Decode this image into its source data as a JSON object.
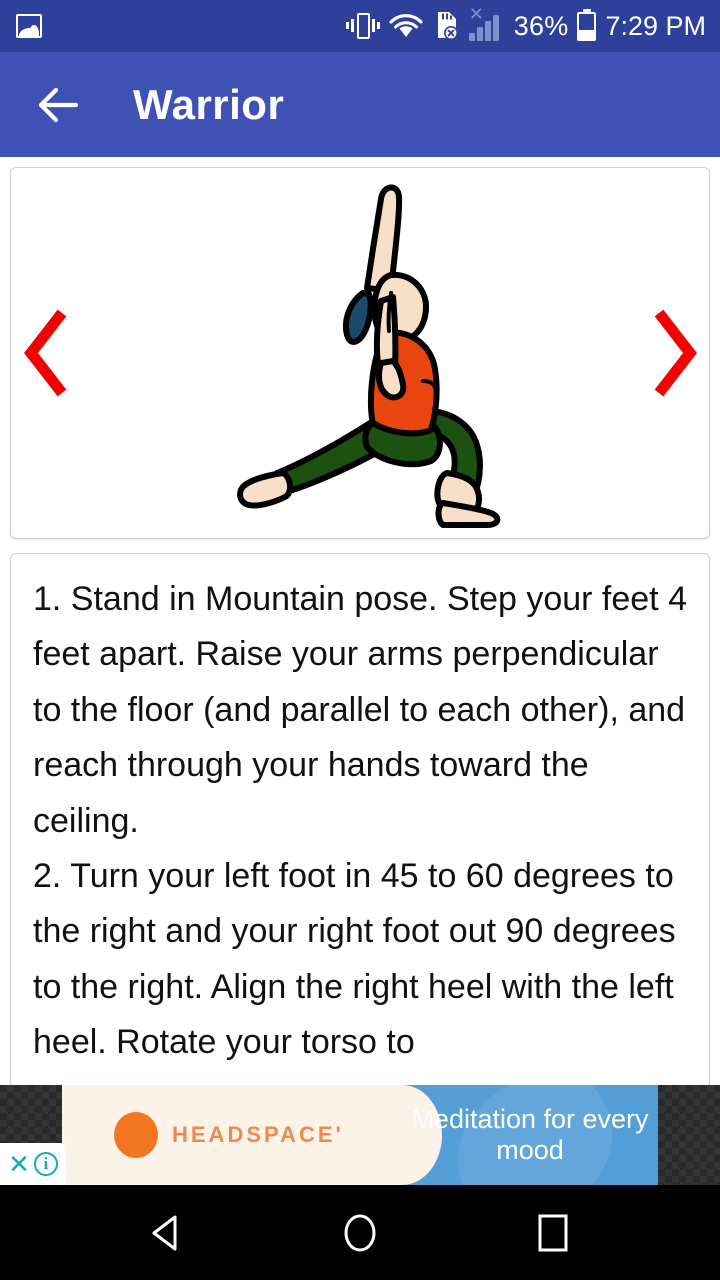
{
  "status_bar": {
    "notification_icon": "photo-icon",
    "icons": [
      "vibrate-icon",
      "wifi-icon",
      "sd-card-error-icon",
      "signal-bars-icon"
    ],
    "battery_percent": "36%",
    "time": "7:29 PM",
    "background_color": "#2f409b"
  },
  "app_bar": {
    "back_icon": "back-arrow-icon",
    "title": "Warrior",
    "background_color": "#3f51b5"
  },
  "pose_card": {
    "prev_icon": "chevron-left-icon",
    "next_icon": "chevron-right-icon",
    "arrow_color": "#f40000",
    "illustration_name": "warrior-pose-illustration",
    "illustration_colors": {
      "skin": "#f7dfc8",
      "top": "#e8450f",
      "pants": "#1d5110",
      "hair": "#1b4a6b",
      "outline": "#000000"
    }
  },
  "instructions": {
    "step1": "1. Stand in Mountain pose. Step your feet 4 feet apart. Raise your arms perpendicular to the floor (and parallel to each other), and reach through your hands toward the ceiling.",
    "step2": "2. Turn your left foot in 45 to 60 degrees to the right and your right foot out 90 degrees to the right. Align the right heel with the left heel. Rotate your torso to"
  },
  "ad": {
    "brand": "HEADSPACE'",
    "tagline": "Meditation for every mood",
    "close_icon": "close-x-icon",
    "info_icon": "ad-info-icon",
    "brand_color": "#f2761f",
    "panel_color": "#4596d6"
  },
  "nav_bar": {
    "back_icon": "nav-back-triangle-icon",
    "home_icon": "nav-home-circle-icon",
    "recents_icon": "nav-recents-square-icon"
  }
}
